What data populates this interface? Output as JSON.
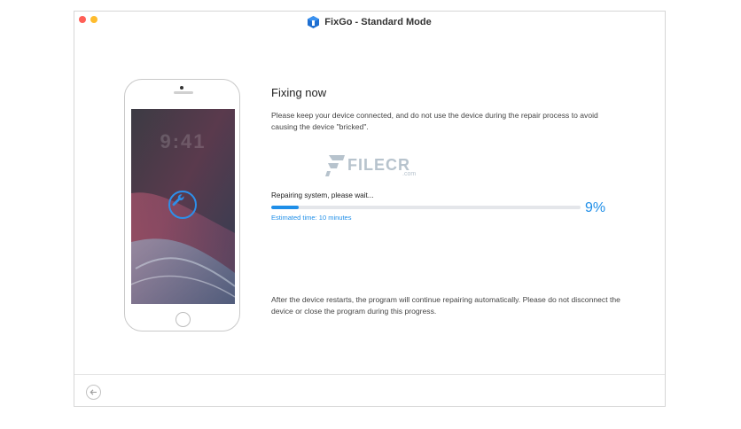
{
  "window": {
    "title": "FixGo - Standard Mode"
  },
  "phone": {
    "clock": "9:41"
  },
  "main": {
    "heading": "Fixing now",
    "description": "Please keep your device connected, and do not use the device during the repair process to avoid causing the device \"bricked\".",
    "progress": {
      "label": "Repairing system, please wait...",
      "percent_text": "9%",
      "value": 0.09,
      "estimate": "Estimated time: 10 minutes"
    },
    "after_note": "After the device restarts, the program will continue repairing automatically. Please do not disconnect the device or close the program during this progress."
  },
  "watermark": {
    "text": "FILECR",
    "sub": ".com"
  },
  "icons": {
    "app": "fixgo-app-icon",
    "wrench": "wrench-icon",
    "back": "back-arrow-icon"
  },
  "colors": {
    "accent": "#1e8ee8",
    "track": "#e4e6ea"
  }
}
